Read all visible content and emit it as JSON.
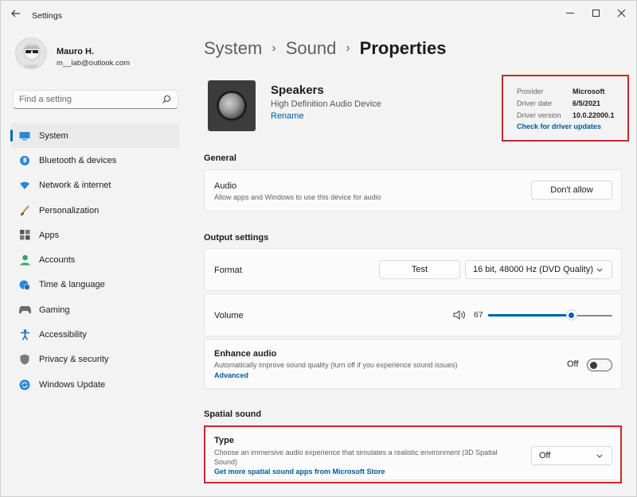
{
  "window": {
    "title": "Settings"
  },
  "profile": {
    "name": "Mauro H.",
    "email": "m__lab@outlook.com"
  },
  "search": {
    "placeholder": "Find a setting"
  },
  "sidebar": {
    "items": [
      {
        "label": "System",
        "icon": "monitor-icon",
        "active": true
      },
      {
        "label": "Bluetooth & devices",
        "icon": "bluetooth-icon"
      },
      {
        "label": "Network & internet",
        "icon": "wifi-icon"
      },
      {
        "label": "Personalization",
        "icon": "brush-icon"
      },
      {
        "label": "Apps",
        "icon": "apps-icon"
      },
      {
        "label": "Accounts",
        "icon": "person-icon"
      },
      {
        "label": "Time & language",
        "icon": "globe-clock-icon"
      },
      {
        "label": "Gaming",
        "icon": "gamepad-icon"
      },
      {
        "label": "Accessibility",
        "icon": "accessibility-icon"
      },
      {
        "label": "Privacy & security",
        "icon": "shield-icon"
      },
      {
        "label": "Windows Update",
        "icon": "update-icon"
      }
    ]
  },
  "breadcrumb": {
    "items": [
      "System",
      "Sound"
    ],
    "current": "Properties"
  },
  "device": {
    "name": "Speakers",
    "description": "High Definition Audio Device",
    "rename": "Rename"
  },
  "driver": {
    "provider_label": "Provider",
    "provider": "Microsoft",
    "date_label": "Driver date",
    "date": "6/5/2021",
    "version_label": "Driver version",
    "version": "10.0.22000.1",
    "update_link": "Check for driver updates"
  },
  "general": {
    "heading": "General",
    "audio": {
      "title": "Audio",
      "subtitle": "Allow apps and Windows to use this device for audio",
      "button": "Don't allow"
    }
  },
  "output": {
    "heading": "Output settings",
    "format": {
      "title": "Format",
      "test_button": "Test",
      "selected": "16 bit, 48000 Hz (DVD Quality)"
    },
    "volume": {
      "title": "Volume",
      "value": "67",
      "level": 0.67
    },
    "enhance": {
      "title": "Enhance audio",
      "subtitle": "Automatically improve sound quality (turn off if you experience sound issues)",
      "link": "Advanced",
      "state": "Off"
    }
  },
  "spatial": {
    "heading": "Spatial sound",
    "type": {
      "title": "Type",
      "subtitle": "Choose an immersive audio experience that simulates a realistic environment (3D Spatial Sound)",
      "link": "Get more spatial sound apps from Microsoft Store",
      "selected": "Off"
    }
  },
  "colors": {
    "accent": "#005fb8",
    "highlight": "#c42b2b",
    "link": "#005a9e"
  }
}
